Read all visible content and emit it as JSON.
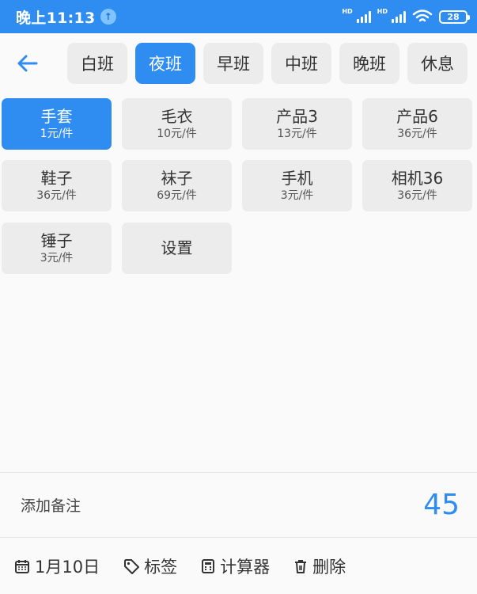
{
  "status": {
    "time": "晚上11:13",
    "network_badge_1": "HD",
    "network_badge_2": "HD",
    "battery": "28"
  },
  "shifts": [
    {
      "label": "白班"
    },
    {
      "label": "夜班",
      "active": true
    },
    {
      "label": "早班"
    },
    {
      "label": "中班"
    },
    {
      "label": "晚班"
    },
    {
      "label": "休息"
    }
  ],
  "items": [
    {
      "name": "手套",
      "price": "1元/件",
      "active": true
    },
    {
      "name": "毛衣",
      "price": "10元/件"
    },
    {
      "name": "产品3",
      "price": "13元/件"
    },
    {
      "name": "产品6",
      "price": "36元/件"
    },
    {
      "name": "鞋子",
      "price": "36元/件"
    },
    {
      "name": "袜子",
      "price": "69元/件"
    },
    {
      "name": "手机",
      "price": "3元/件"
    },
    {
      "name": "相机36",
      "price": "36元/件"
    },
    {
      "name": "锤子",
      "price": "3元/件"
    },
    {
      "name": "设置"
    }
  ],
  "note": {
    "label": "添加备注",
    "total": "45"
  },
  "bottom": {
    "date": "1月10日",
    "tag": "标签",
    "calculator": "计算器",
    "delete": "删除"
  },
  "colors": {
    "accent": "#2f8cf0",
    "tile": "#ececec"
  },
  "icons": [
    "back-arrow-icon",
    "upload-icon",
    "signal-icon",
    "wifi-icon",
    "battery-icon",
    "calendar-icon",
    "tag-icon",
    "calculator-icon",
    "trash-icon"
  ]
}
